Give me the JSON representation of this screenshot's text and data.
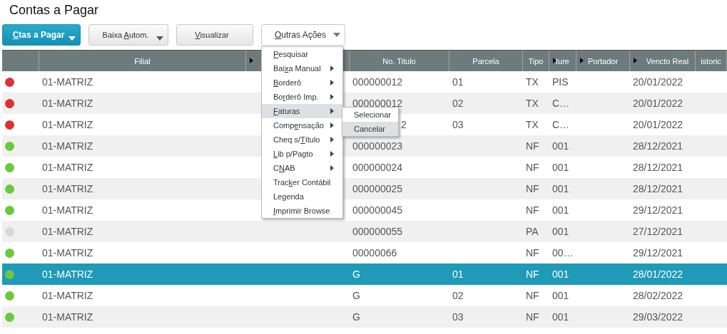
{
  "title": "Contas a Pagar",
  "buttons": [
    {
      "label": {
        "key": "C",
        "post": "tas a Pagar"
      },
      "kind": "primary",
      "dropdown": true
    },
    {
      "label": {
        "pre": "Baixa ",
        "key": "A",
        "post": "utom."
      },
      "kind": "normal",
      "dropdown": true
    },
    {
      "label": {
        "key": "V",
        "post": "isualizar"
      },
      "kind": "normal",
      "dropdown": false
    },
    {
      "label": {
        "key": "O",
        "post": "utras Ações"
      },
      "kind": "menu",
      "dropdown": true
    }
  ],
  "table": {
    "columns": [
      {
        "kind": "status",
        "arrow": false
      },
      {
        "label": "Filial",
        "kind": "text",
        "arrow": false
      },
      {
        "kind": "text",
        "arrow": true
      },
      {
        "label": "No. Titulo",
        "kind": "text",
        "arrow": false
      },
      {
        "label": "Parcela",
        "kind": "text",
        "arrow": false
      },
      {
        "label": "Tipo",
        "kind": "text",
        "arrow": false
      },
      {
        "label": "ture",
        "kind": "text",
        "arrow": true
      },
      {
        "label": "Portador",
        "kind": "text",
        "arrow": true
      },
      {
        "label": "Vencto Real",
        "kind": "text",
        "arrow": true
      },
      {
        "label": "istoric",
        "kind": "text",
        "arrow": false
      }
    ],
    "rows": [
      {
        "color": "#e03030",
        "selected": false,
        "cells": [
          "",
          "01-MATRIZ",
          "",
          "000000012",
          "01",
          "TX",
          "PIS",
          "",
          "20/01/2022",
          ""
        ]
      },
      {
        "color": "#e03030",
        "selected": false,
        "cells": [
          "",
          "01-MATRIZ",
          "",
          "000000012",
          "02",
          "TX",
          "C…",
          "",
          "20/01/2022",
          ""
        ]
      },
      {
        "color": "#e03030",
        "selected": false,
        "cells": [
          "",
          "01-MATRIZ",
          "",
          {
            "text": "2",
            "kind": "tail"
          },
          "03",
          "TX",
          "C…",
          "",
          "20/01/2022",
          ""
        ]
      },
      {
        "color": "#6cc83c",
        "selected": false,
        "cells": [
          "",
          "01-MATRIZ",
          "",
          "000000023",
          "",
          "NF",
          "001",
          "",
          "28/12/2021",
          ""
        ]
      },
      {
        "color": "#6cc83c",
        "selected": false,
        "cells": [
          "",
          "01-MATRIZ",
          "",
          "000000024",
          "",
          "NF",
          "001",
          "",
          "28/12/2021",
          ""
        ]
      },
      {
        "color": "#6cc83c",
        "selected": false,
        "cells": [
          "",
          "01-MATRIZ",
          "",
          "000000025",
          "",
          "NF",
          "001",
          "",
          "28/12/2021",
          ""
        ]
      },
      {
        "color": "#6cc83c",
        "selected": false,
        "cells": [
          "",
          "01-MATRIZ",
          "",
          "000000045",
          "",
          "NF",
          "001",
          "",
          "29/12/2021",
          ""
        ]
      },
      {
        "color": "#d8d8d8",
        "selected": false,
        "cells": [
          "",
          "01-MATRIZ",
          "",
          "000000055",
          "",
          "PA",
          "001",
          "",
          "27/12/2021",
          ""
        ]
      },
      {
        "color": "#6cc83c",
        "selected": false,
        "cells": [
          "",
          "01-MATRIZ",
          "",
          "00000066",
          "",
          "NF",
          "00…",
          "",
          "29/12/2021",
          ""
        ]
      },
      {
        "color": "#6cc83c",
        "selected": true,
        "cells": [
          "",
          "01-MATRIZ",
          "",
          "G",
          "01",
          "NF",
          "001",
          "",
          "28/01/2022",
          ""
        ]
      },
      {
        "color": "#6cc83c",
        "selected": false,
        "cells": [
          "",
          "01-MATRIZ",
          "",
          "G",
          "02",
          "NF",
          "001",
          "",
          "28/02/2022",
          ""
        ]
      },
      {
        "color": "#6cc83c",
        "selected": false,
        "cells": [
          "",
          "01-MATRIZ",
          "",
          "G",
          "03",
          "NF",
          "001",
          "",
          "29/03/2022",
          ""
        ]
      }
    ]
  },
  "menu": {
    "items": [
      {
        "label": {
          "key": "P",
          "post": "esquisar"
        },
        "submenu": false,
        "selected": false
      },
      {
        "label": {
          "pre": "Bai",
          "key": "x",
          "post": "a Manual"
        },
        "submenu": true,
        "selected": false
      },
      {
        "label": {
          "key": "B",
          "post": "orderô"
        },
        "submenu": true,
        "selected": false
      },
      {
        "label": {
          "pre": "Bo",
          "key": "r",
          "post": "derô Imp."
        },
        "submenu": true,
        "selected": false
      },
      {
        "label": {
          "key": "F",
          "post": "aturas"
        },
        "submenu": true,
        "selected": true,
        "children": [
          {
            "label": {
              "post": "Selecionar"
            },
            "selected": false
          },
          {
            "label": {
              "post": "Cancelar"
            },
            "selected": true
          }
        ]
      },
      {
        "label": {
          "pre": "Comp",
          "key": "e",
          "post": "nsação"
        },
        "submenu": true,
        "selected": false
      },
      {
        "label": {
          "pre": "Cheq s/",
          "key": "T",
          "post": "ítulo"
        },
        "submenu": true,
        "selected": false
      },
      {
        "label": {
          "key": "L",
          "post": "ib p/Pagto"
        },
        "submenu": true,
        "selected": false
      },
      {
        "label": {
          "pre": "C",
          "key": "N",
          "post": "AB"
        },
        "submenu": true,
        "selected": false
      },
      {
        "label": {
          "pre": "Trac",
          "key": "k",
          "post": "er Contábil"
        },
        "submenu": false,
        "selected": false
      },
      {
        "label": {
          "pre": "Le",
          "key": "g",
          "post": "enda"
        },
        "submenu": false,
        "selected": false
      },
      {
        "label": {
          "key": "I",
          "post": "mprimir Browse"
        },
        "submenu": false,
        "selected": false
      }
    ]
  }
}
